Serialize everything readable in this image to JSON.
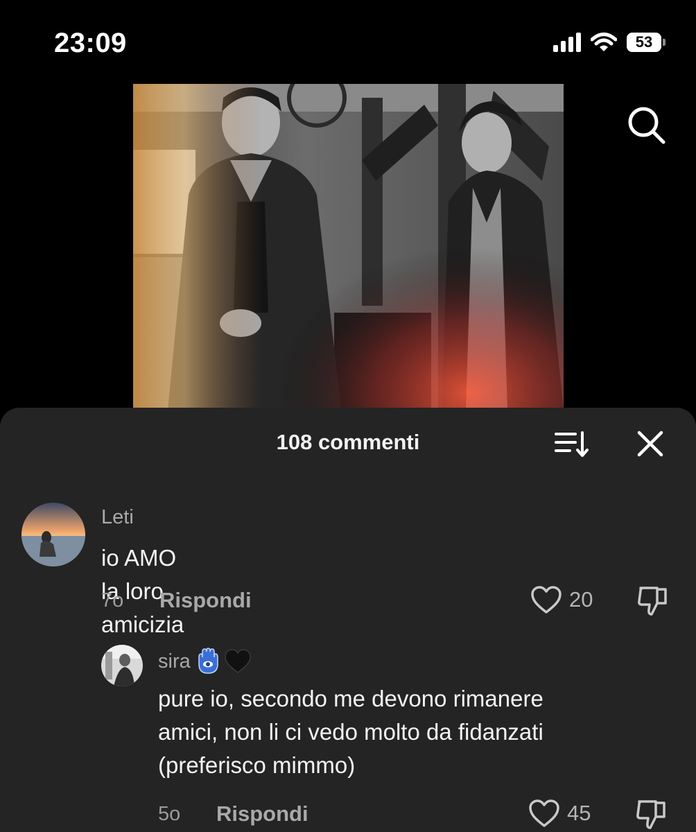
{
  "status_bar": {
    "time": "23:09",
    "battery_level": "53",
    "icons": [
      "cellular-signal-icon",
      "wifi-icon",
      "battery-icon"
    ]
  },
  "video": {
    "search_icon": "search-icon"
  },
  "comments_sheet": {
    "title": "108 commenti",
    "sort_icon": "sort-icon",
    "close_icon": "close-icon",
    "comments": [
      {
        "username": "Leti",
        "text": "io AMO la loro amicizia",
        "time": "7o",
        "reply_label": "Rispondi",
        "likes": "20"
      },
      {
        "username": "sira",
        "username_emoji": [
          "hamsa-emoji",
          "black-heart-emoji"
        ],
        "text_lines": [
          "pure io, secondo me devono rimanere",
          "amici, non li ci vedo molto da fidanzati",
          "(preferisco mimmo)"
        ],
        "time": "5o",
        "reply_label": "Rispondi",
        "likes": "45"
      }
    ]
  },
  "colors": {
    "background": "#000000",
    "sheet": "#242424",
    "primary_text": "#f4f4f4",
    "secondary_text": "#a9a9a9"
  }
}
